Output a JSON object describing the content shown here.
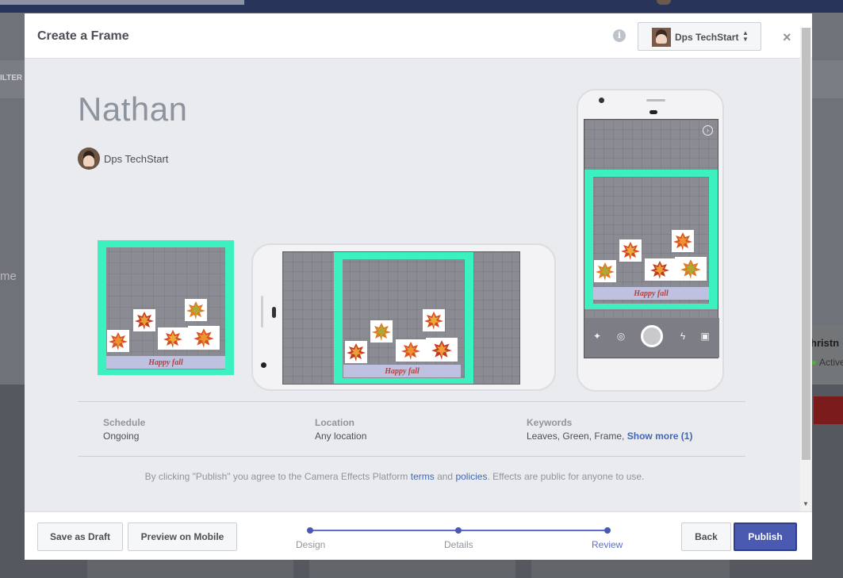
{
  "background": {
    "filter_label": "ILTER",
    "side_text": "me",
    "card_title": "hristn",
    "card_status": "Active"
  },
  "modal": {
    "title": "Create a Frame",
    "page_selector": {
      "label": "Dps TechStart"
    },
    "effect_name": "Nathan",
    "owner_name": "Dps TechStart",
    "preview": {
      "caption": "Happy fall"
    },
    "schedule": {
      "label": "Schedule",
      "value": "Ongoing"
    },
    "location": {
      "label": "Location",
      "value": "Any location"
    },
    "keywords": {
      "label": "Keywords",
      "value": "Leaves, Green, Frame,",
      "show_more": "Show more (1)"
    },
    "terms": {
      "prefix": "By clicking \"Publish\" you agree to the Camera Effects Platform",
      "terms_link": "terms",
      "and": "and",
      "policies_link": "policies",
      "suffix": ". Effects are public for anyone to use."
    },
    "footer": {
      "save_draft": "Save as Draft",
      "preview_mobile": "Preview on Mobile",
      "back": "Back",
      "publish": "Publish",
      "steps": [
        {
          "label": "Design"
        },
        {
          "label": "Details"
        },
        {
          "label": "Review"
        }
      ],
      "active_step": "Review"
    }
  },
  "colors": {
    "frame_green": "#3cf0c0",
    "publish_blue": "#4a5ab0",
    "link_blue": "#4267b2"
  }
}
